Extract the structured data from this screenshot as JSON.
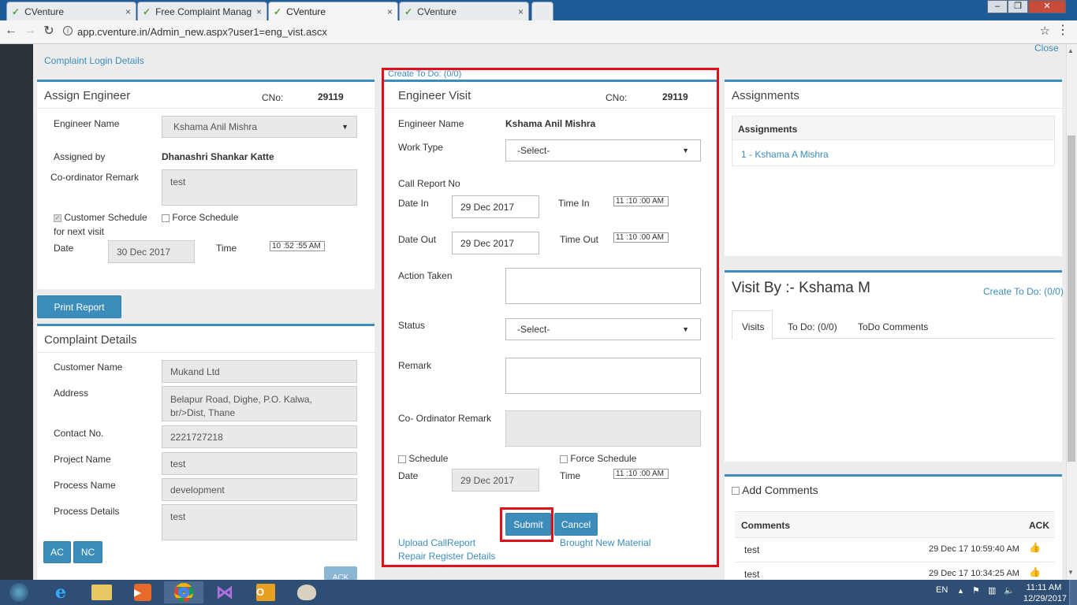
{
  "browser": {
    "tabs": [
      {
        "title": "CVenture",
        "close": "×"
      },
      {
        "title": "Free Complaint Managem",
        "close": "×"
      },
      {
        "title": "CVenture",
        "close": "×"
      },
      {
        "title": "CVenture",
        "close": "×"
      }
    ],
    "url": "app.cventure.in/Admin_new.aspx?user1=eng_vist.ascx",
    "window_buttons": [
      "–",
      "❐",
      "✕"
    ]
  },
  "page": {
    "complaint_login_details": "Complaint Login Details",
    "create_todo_top": "Create To Do: (0/0)",
    "close_link": "Close"
  },
  "assign_engineer": {
    "title": "Assign Engineer",
    "cno_label": "CNo:",
    "cno_value": "29119",
    "engineer_name_label": "Engineer Name",
    "engineer_name_value": "Kshama Anil Mishra",
    "assigned_by_label": "Assigned by",
    "assigned_by_value": "Dhanashri Shankar Katte",
    "coordinator_remark_label": "Co-ordinator Remark",
    "coordinator_remark_value": "test",
    "customer_schedule_label": "Customer Schedule",
    "for_next_visit_label": "for next visit",
    "force_schedule_label": "Force Schedule",
    "date_label": "Date",
    "date_value": "30 Dec 2017",
    "time_label": "Time",
    "time_value": "10 :52 :55  AM"
  },
  "print_report_label": "Print Report",
  "complaint_details": {
    "title": "Complaint Details",
    "customer_name_label": "Customer Name",
    "customer_name_value": "Mukand Ltd",
    "address_label": "Address",
    "address_line1": "Belapur Road, Dighe, P.O. Kalwa,",
    "address_line2": "br/>Dist, Thane",
    "contact_label": "Contact No.",
    "contact_value": "2221727218",
    "project_label": "Project Name",
    "project_value": "test",
    "process_label": "Process Name",
    "process_value": "development",
    "process_details_label": "Process Details",
    "process_details_value": "test",
    "ac_label": "AC",
    "nc_label": "NC",
    "ack_label": "ACK"
  },
  "engineer_visit": {
    "title": "Engineer Visit",
    "cno_label": "CNo:",
    "cno_value": "29119",
    "engineer_name_label": "Engineer Name",
    "engineer_name_value": "Kshama Anil Mishra",
    "work_type_label": "Work Type",
    "work_type_value": "-Select-",
    "call_report_label": "Call Report No",
    "date_in_label": "Date In",
    "date_in_value": "29 Dec 2017",
    "time_in_label": "Time In",
    "time_in_value": "11 :10 :00  AM",
    "date_out_label": "Date Out",
    "date_out_value": "29 Dec 2017",
    "time_out_label": "Time Out",
    "time_out_value": "11 :10 :00  AM",
    "action_taken_label": "Action Taken",
    "status_label": "Status",
    "status_value": "-Select-",
    "remark_label": "Remark",
    "coordinator_remark_label": "Co- Ordinator Remark",
    "schedule_label": "Schedule",
    "force_schedule_label": "Force Schedule",
    "date_label": "Date",
    "date_value": "29 Dec 2017",
    "time_label": "Time",
    "time_value": "11 :10 :00  AM",
    "submit_label": "Submit",
    "cancel_label": "Cancel",
    "upload_call_report": "Upload CallReport",
    "brought_new_material": "Brought New Material",
    "repair_register": "Repair Register Details"
  },
  "assignments": {
    "title": "Assignments",
    "header": "Assignments",
    "item": "1 - Kshama A Mishra"
  },
  "visit_by": {
    "title": "Visit By :- Kshama M",
    "create_todo": "Create To Do: (0/0)",
    "tabs": [
      "Visits",
      "To Do: (0/0)",
      "ToDo Comments"
    ]
  },
  "comments": {
    "title": "Add Comments",
    "col_comments": "Comments",
    "col_ack": "ACK",
    "rows": [
      {
        "text": "test",
        "time": "29 Dec 17 10:59:40 AM"
      },
      {
        "text": "test",
        "time": "29 Dec 17 10:34:25 AM"
      }
    ]
  },
  "taskbar": {
    "lang": "EN",
    "time": "11:11 AM",
    "date": "12/29/2017"
  }
}
